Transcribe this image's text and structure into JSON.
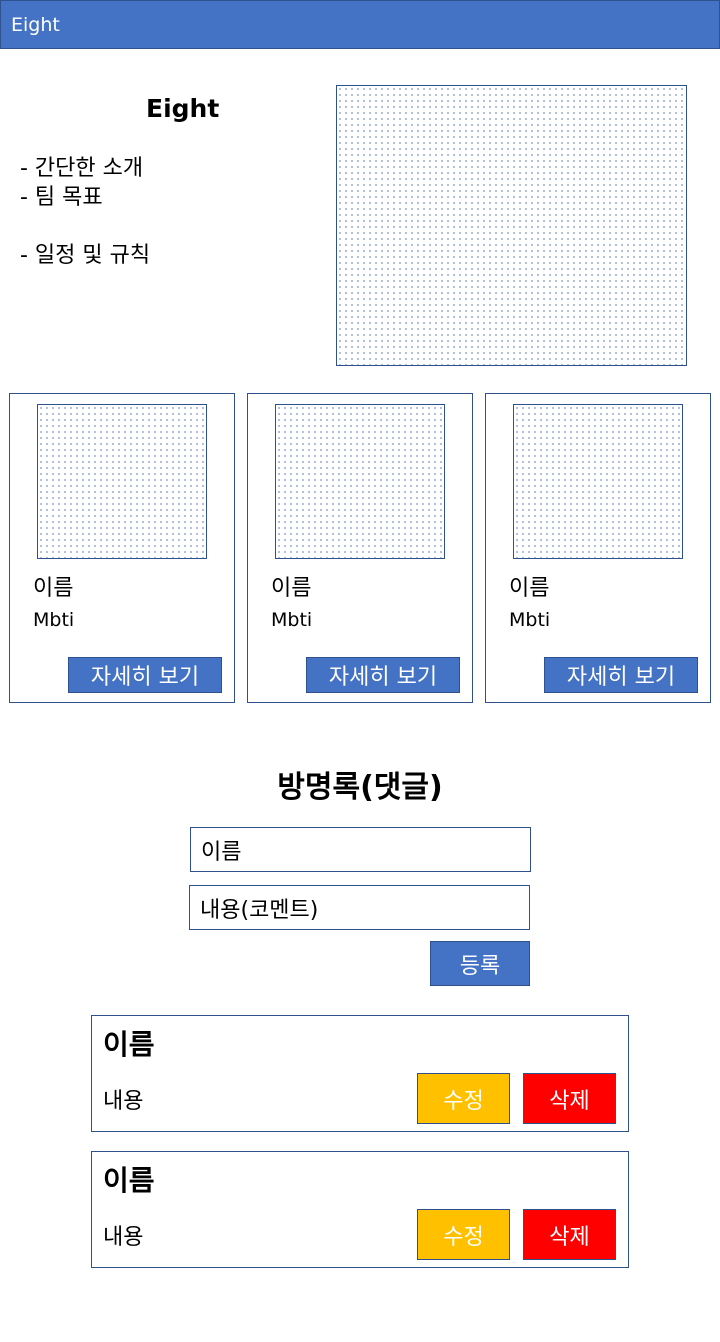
{
  "header": {
    "title": "Eight"
  },
  "intro": {
    "title": "Eight",
    "lines": [
      "- 간단한 소개",
      "- 팀 목표",
      "- 일정 및 규칙"
    ]
  },
  "members": [
    {
      "name": "이름",
      "mbti": "Mbti",
      "button": "자세히 보기"
    },
    {
      "name": "이름",
      "mbti": "Mbti",
      "button": "자세히 보기"
    },
    {
      "name": "이름",
      "mbti": "Mbti",
      "button": "자세히 보기"
    }
  ],
  "guestbook": {
    "title": "방명록(댓글)",
    "name_placeholder": "이름",
    "content_placeholder": "내용(코멘트)",
    "submit_label": "등록"
  },
  "comments": [
    {
      "name": "이름",
      "content": "내용",
      "edit_label": "수정",
      "delete_label": "삭제"
    },
    {
      "name": "이름",
      "content": "내용",
      "edit_label": "수정",
      "delete_label": "삭제"
    }
  ],
  "colors": {
    "primary": "#4472c4",
    "border": "#2f528f",
    "edit": "#ffc000",
    "delete": "#ff0000"
  }
}
